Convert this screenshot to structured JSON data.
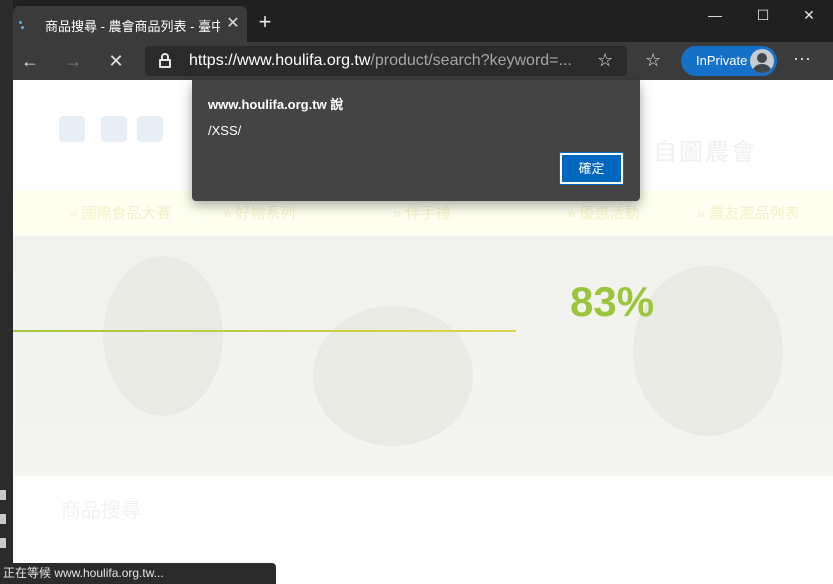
{
  "tab": {
    "title": "商品搜尋 - 農會商品列表 - 臺中",
    "close_glyph": "✕",
    "new_tab_glyph": "+"
  },
  "window_controls": {
    "minimize": "—",
    "maximize": "☐",
    "close": "✕"
  },
  "toolbar": {
    "back_glyph": "←",
    "forward_glyph": "→",
    "stop_glyph": "✕",
    "url_prefix": "https://",
    "url_host": "www.houlifa.org.tw",
    "url_path": "/product/search?keyword=...",
    "favorite_glyph": "☆",
    "favorites_glyph": "☆",
    "inprivate_label": "InPrivate",
    "more_glyph": "···"
  },
  "dialog": {
    "title": "www.houlifa.org.tw 說",
    "message": "/XSS/",
    "ok_label": "確定"
  },
  "page": {
    "loading_percent": "83%",
    "brand_text": "自圖農會",
    "section_title": "商品搜尋",
    "nav_items": [
      "»  國際食品大賽",
      "» 好物系列",
      "» 伴手禮",
      "» 優惠活動",
      "» 農友產品列表"
    ]
  },
  "status_bar": {
    "text": "正在等候 www.houlifa.org.tw..."
  },
  "colors": {
    "accent_blue": "#1570c7",
    "progress_green": "#9ac63c",
    "dialog_bg": "#444444"
  }
}
